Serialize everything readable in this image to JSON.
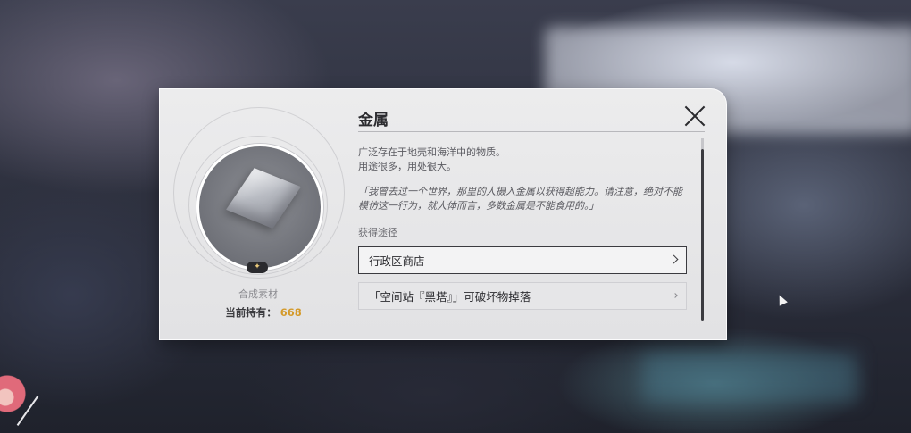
{
  "item": {
    "name": "金属",
    "description_lines": [
      "广泛存在于地壳和海洋中的物质。",
      "用途很多，用处很大。"
    ],
    "flavor_text": "「我曾去过一个世界，那里的人摄入金属以获得超能力。请注意，绝对不能模仿这一行为，就人体而言，多数金属是不能食用的。」",
    "category": "合成素材",
    "holding_label": "当前持有：",
    "holding_count": "668",
    "rarity_glyph": "✦"
  },
  "sources": {
    "header": "获得途径",
    "items": [
      {
        "label": "行政区商店"
      },
      {
        "label": "「空间站『黑塔』」可破坏物掉落"
      }
    ]
  },
  "colors": {
    "count_accent": "#d49a2a",
    "dialog_bg": "#e8e8ea",
    "text_dark": "#2c2c30"
  },
  "icons": {
    "close": "close-icon",
    "item": "metal-cube-icon",
    "rarity": "star-icon",
    "chevron": "chevron-right-icon",
    "cursor": "mouse-cursor-icon"
  }
}
